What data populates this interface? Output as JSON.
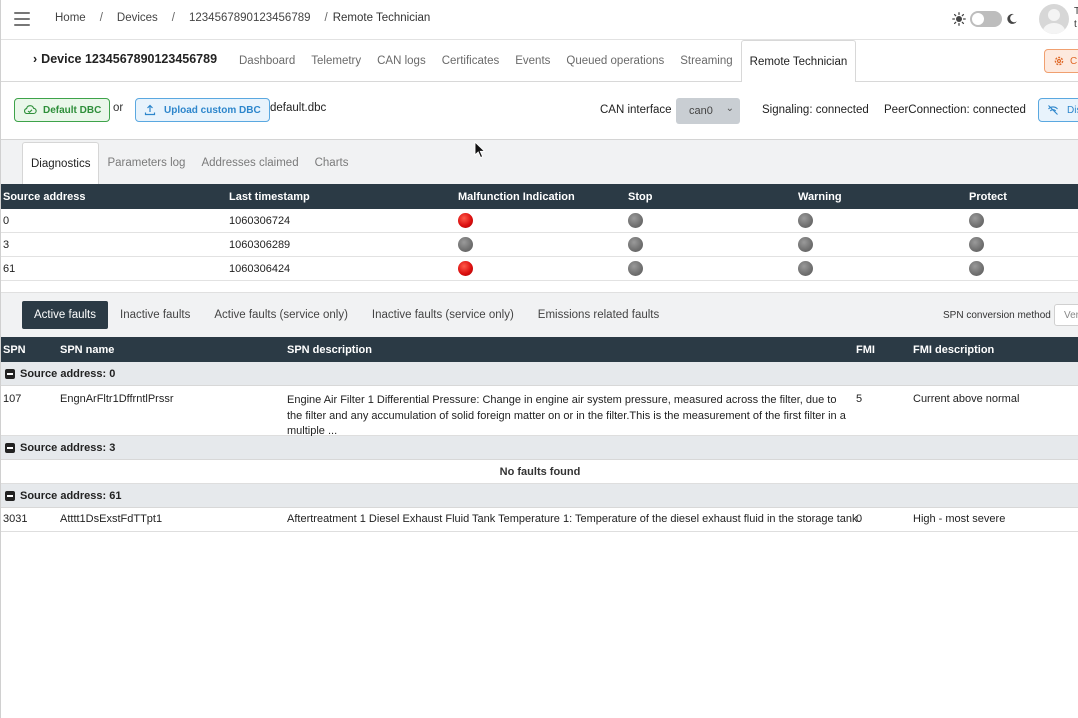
{
  "topbar": {
    "breadcrumb": [
      "Home",
      "Devices",
      "1234567890123456789",
      "Remote Technician"
    ],
    "user_initials": "T\nt"
  },
  "device": {
    "title": "Device 1234567890123456789",
    "tabs": [
      "Dashboard",
      "Telemetry",
      "CAN logs",
      "Certificates",
      "Events",
      "Queued operations",
      "Streaming",
      "Remote Technician"
    ],
    "active_tab": "Remote Technician",
    "action_button": "C"
  },
  "dbc": {
    "default_label": "Default DBC",
    "or": "or",
    "upload_label": "Upload custom DBC",
    "file": "default.dbc",
    "can_interface_label": "CAN interface",
    "can_interface_value": "can0",
    "signaling": "Signaling: connected",
    "peer": "PeerConnection: connected",
    "disconnect_label": "Dis"
  },
  "subtabs": [
    "Diagnostics",
    "Parameters log",
    "Addresses claimed",
    "Charts"
  ],
  "lamps": {
    "headers": [
      "Source address",
      "Last timestamp",
      "Malfunction Indication",
      "Stop",
      "Warning",
      "Protect"
    ],
    "rows": [
      {
        "source": "0",
        "timestamp": "1060306724",
        "mil": true,
        "stop": false,
        "warning": false,
        "protect": false
      },
      {
        "source": "3",
        "timestamp": "1060306289",
        "mil": false,
        "stop": false,
        "warning": false,
        "protect": false
      },
      {
        "source": "61",
        "timestamp": "1060306424",
        "mil": true,
        "stop": false,
        "warning": false,
        "protect": false
      }
    ],
    "on_color": "#dc1010",
    "off_color": "#6f6f6f"
  },
  "fault_tabs": [
    "Active faults",
    "Inactive faults",
    "Active faults (service only)",
    "Inactive faults (service only)",
    "Emissions related faults"
  ],
  "spn_conversion": {
    "label": "SPN conversion method",
    "value": "Vers"
  },
  "faults": {
    "headers": [
      "SPN",
      "SPN name",
      "SPN description",
      "FMI",
      "FMI description"
    ],
    "groups": [
      {
        "label": "Source address: 0",
        "rows": [
          {
            "spn": "107",
            "name": "EngnArFltr1DffrntlPrssr",
            "desc": "Engine Air Filter 1 Differential Pressure: Change in engine air system pressure, measured across the filter, due to the filter and any accumulation of solid foreign matter on or in the filter.This is the measurement of the first filter in a multiple ...",
            "fmi": "5",
            "fmi_desc": "Current above normal"
          }
        ]
      },
      {
        "label": "Source address: 3",
        "empty": "No faults found"
      },
      {
        "label": "Source address: 61",
        "rows": [
          {
            "spn": "3031",
            "name": "Atttt1DsExstFdTTpt1",
            "desc": "Aftertreatment 1 Diesel Exhaust Fluid Tank Temperature 1: Temperature of the diesel exhaust fluid in the storage tank.",
            "fmi": "0",
            "fmi_desc": "High - most severe"
          }
        ]
      }
    ]
  },
  "colors": {
    "header_dark": "#2b3a45",
    "green": "#2e8f3a",
    "blue": "#2d86cc",
    "orange": "#e06a2a"
  }
}
